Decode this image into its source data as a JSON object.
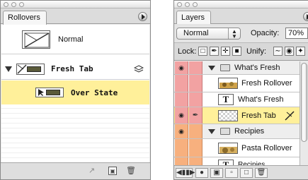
{
  "rollovers_panel": {
    "tab_label": "Rollovers",
    "rows": {
      "normal": {
        "label": "Normal"
      },
      "fresh_tab": {
        "label": "Fresh Tab"
      },
      "over_state": {
        "label": "Over State"
      }
    },
    "footer_icons": [
      "new-slice-icon",
      "new-state-icon",
      "trash-icon"
    ]
  },
  "layers_panel": {
    "tab_label": "Layers",
    "blend_mode": "Normal",
    "opacity_label": "Opacity:",
    "opacity_value": "70%",
    "lock_label": "Lock:",
    "unify_label": "Unify:",
    "layers": [
      {
        "name": "What's Fresh",
        "kind": "group"
      },
      {
        "name": "Fresh Rollover",
        "kind": "image"
      },
      {
        "name": "What's Fresh",
        "kind": "text"
      },
      {
        "name": "Fresh Tab",
        "kind": "checker",
        "selected": true
      },
      {
        "name": "Recipies",
        "kind": "group"
      },
      {
        "name": "Pasta Rollover",
        "kind": "image"
      },
      {
        "name": "Recipies",
        "kind": "text"
      }
    ]
  },
  "colors": {
    "selected_row": "#fff09a",
    "visibility_red": "#f2a2a2",
    "visibility_orange": "#f7b07e"
  }
}
